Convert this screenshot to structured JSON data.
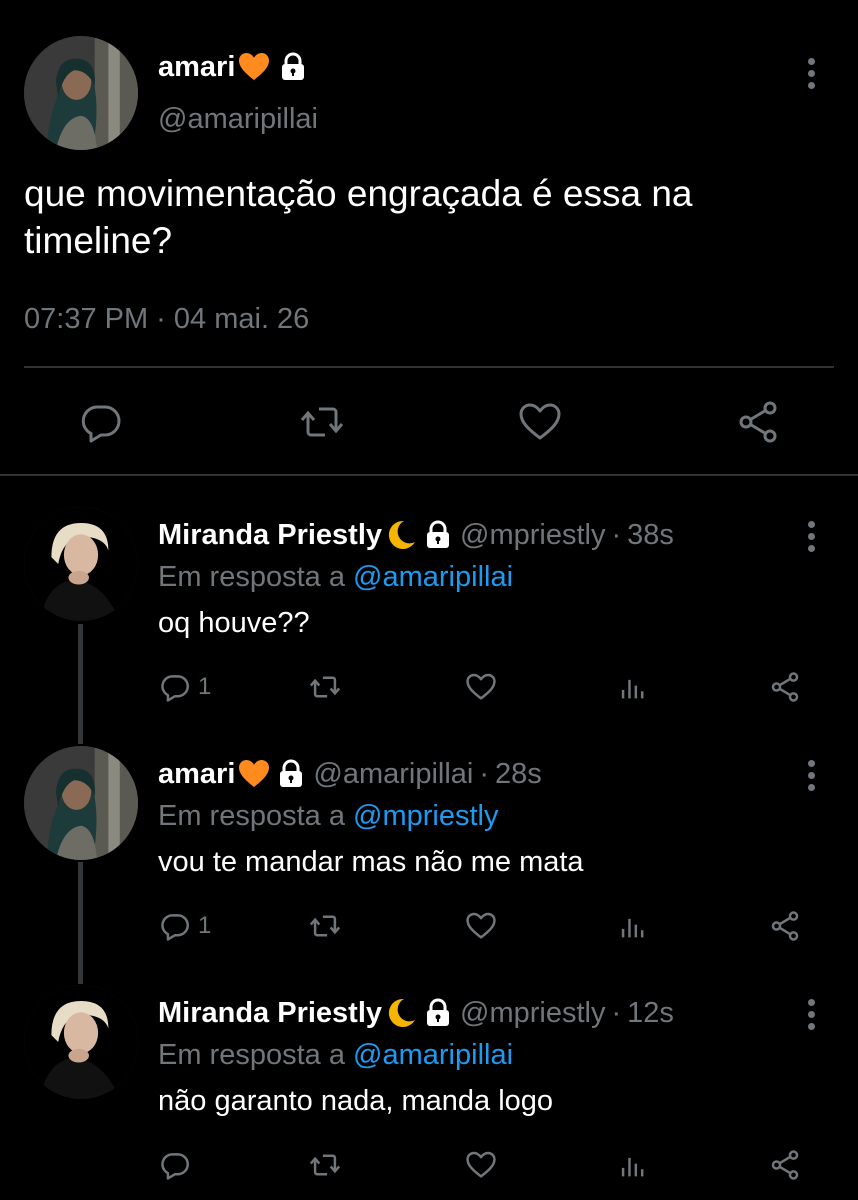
{
  "main_tweet": {
    "author_name": "amari",
    "author_handle": "@amaripillai",
    "text": "que movimentação engraçada é essa na timeline?",
    "timestamp": "07:37 PM · 04 mai. 26",
    "name_emoji": "orange-heart",
    "protected_icon": "lock-icon"
  },
  "reply_prefix": "Em resposta a",
  "replies": [
    {
      "author_name": "Miranda Priestly",
      "name_emoji": "crescent-moon",
      "author_handle": "@mpriestly",
      "separator": "·",
      "time": "38s",
      "in_reply_to": "@amaripillai",
      "text": "oq houve??",
      "reply_count": "1"
    },
    {
      "author_name": "amari",
      "name_emoji": "orange-heart",
      "author_handle": "@amaripillai",
      "separator": "·",
      "time": "28s",
      "in_reply_to": "@mpriestly",
      "text": "vou te mandar mas não me mata",
      "reply_count": "1"
    },
    {
      "author_name": "Miranda Priestly",
      "name_emoji": "crescent-moon",
      "author_handle": "@mpriestly",
      "separator": "·",
      "time": "12s",
      "in_reply_to": "@amaripillai",
      "text": "não garanto nada, manda logo",
      "reply_count": ""
    }
  ],
  "colors": {
    "background": "#000000",
    "text_primary": "#ffffff",
    "text_secondary": "#71767b",
    "accent_link": "#1d9bf0",
    "divider": "#2f3336",
    "heart_emoji": "#ff8a1e",
    "moon_emoji": "#f4b400"
  }
}
